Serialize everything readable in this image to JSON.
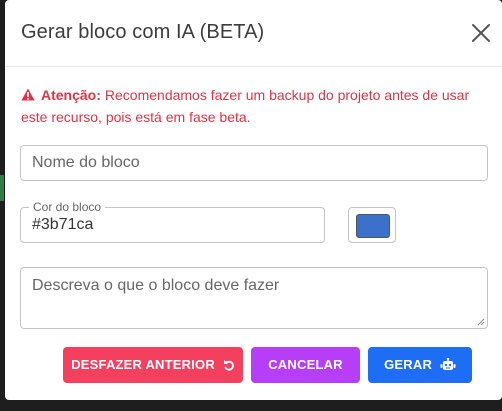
{
  "dialog": {
    "title": "Gerar bloco com IA (BETA)",
    "close_icon": "close-icon"
  },
  "alert": {
    "icon": "warning-icon",
    "label": "Atenção:",
    "message": "Recomendamos fazer um backup do projeto antes de usar este recurso, pois está em fase beta."
  },
  "form": {
    "name_placeholder": "Nome do bloco",
    "color_label": "Cor do bloco",
    "color_value": "#3b71ca",
    "description_placeholder": "Descreva o que o bloco deve fazer"
  },
  "buttons": {
    "undo_label": "DESFAZER ANTERIOR",
    "undo_icon": "undo-icon",
    "cancel_label": "CANCELAR",
    "generate_label": "GERAR",
    "generate_icon": "robot-icon"
  },
  "colors": {
    "alert": "#dc3545",
    "undo": "#f43f5e",
    "cancel": "#b63ef8",
    "generate": "#1d6ef5",
    "swatch": "#3b71ca"
  }
}
